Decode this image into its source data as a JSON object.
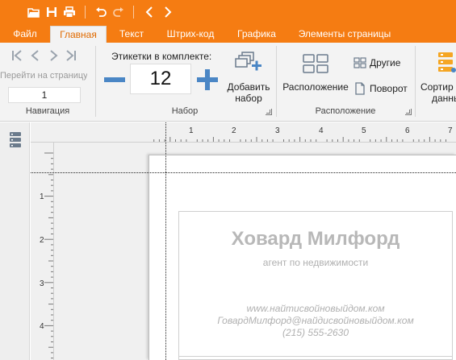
{
  "quick_access": {
    "icons": [
      "folder-open-icon",
      "save-icon",
      "print-icon",
      "undo-icon",
      "redo-icon",
      "prev-icon",
      "next-icon"
    ]
  },
  "tabs": [
    {
      "label": "Файл",
      "active": false
    },
    {
      "label": "Главная",
      "active": true
    },
    {
      "label": "Текст",
      "active": false
    },
    {
      "label": "Штрих-код",
      "active": false
    },
    {
      "label": "Графика",
      "active": false
    },
    {
      "label": "Элементы страницы",
      "active": false
    }
  ],
  "ribbon": {
    "navigation": {
      "goto_label": "Перейти на страницу",
      "page_value": "1",
      "group_label": "Навигация"
    },
    "set": {
      "labels_in_set_label": "Этикетки в комплекте:",
      "count": "12",
      "add_set_label_line1": "Добавить",
      "add_set_label_line2": "набор",
      "group_label": "Набор"
    },
    "layout": {
      "layout_label": "Расположение",
      "other_label": "Другие",
      "rotate_label": "Поворот",
      "group_label": "Расположение"
    },
    "sort": {
      "label_line1": "Сортир",
      "label_line2": "данны"
    }
  },
  "rulers": {
    "horizontal": [
      "1",
      "2",
      "3",
      "4",
      "5",
      "6",
      "7"
    ],
    "vertical": [
      "1",
      "2",
      "3",
      "4"
    ]
  },
  "label_card": {
    "name": "Ховард Милфорд",
    "role": "агент по недвижимости",
    "website": "www.найтисвойновыйдом.ком",
    "email": "ГовардМилфорд@найдисвойновыйдом.ком",
    "phone": "(215) 555-2630"
  },
  "colors": {
    "accent": "#f57c12",
    "ribbon_bg": "#f3f3f3",
    "stepper_blue": "#4a86c5",
    "card_text": "#b8b8b8"
  }
}
